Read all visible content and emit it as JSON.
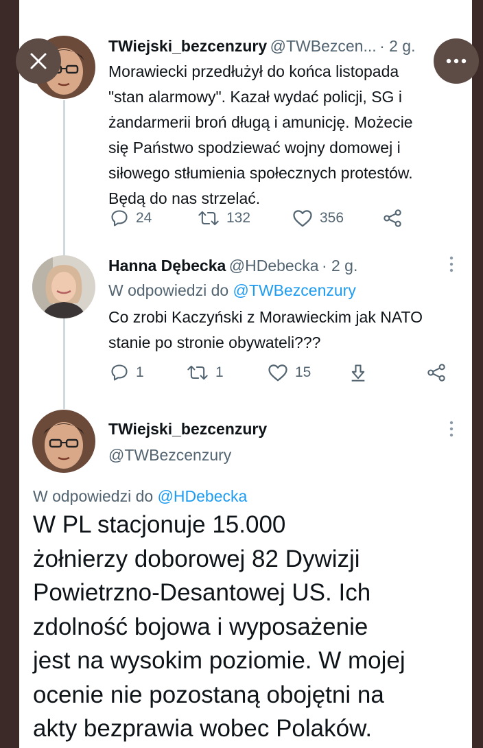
{
  "tweet1": {
    "name": "TWiejski_bezcenzury",
    "handle": "@TWBezcen...",
    "time": "· 2 g.",
    "lines": [
      "Morawiecki przedłużył do końca listopada",
      "\"stan alarmowy\". Kazał wydać policji, SG i",
      "żandarmerii broń długą i amunicję. Możecie",
      "się Państwo spodziewać wojny domowej i",
      "siłowego stłumienia społecznych protestów.",
      "Będą do nas strzelać."
    ],
    "replies": "24",
    "retweets": "132",
    "likes": "356"
  },
  "tweet2": {
    "name": "Hanna Dębecka",
    "handle": "@HDebecka",
    "time": "· 2 g.",
    "reply_prefix": "W odpowiedzi do ",
    "reply_handle": "@TWBezcenzury",
    "lines": [
      "Co zrobi Kaczyński z Morawieckim jak NATO",
      "stanie po stronie obywateli???"
    ],
    "replies": "1",
    "retweets": "1",
    "likes": "15"
  },
  "tweet3": {
    "name": "TWiejski_bezcenzury",
    "handle": "@TWBezcenzury",
    "reply_prefix": "W odpowiedzi do ",
    "reply_handle": "@HDebecka",
    "lines": [
      "W PL stacjonuje 15.000",
      "żołnierzy doborowej 82 Dywizji",
      "Powietrzno-Desantowej US. Ich",
      "zdolność bojowa i wyposażenie",
      "jest na wysokim poziomie. W mojej",
      "ocenie nie pozostaną obojętni na",
      "akty bezprawia wobec Polaków."
    ]
  },
  "icons": {
    "close": "close-icon",
    "more": "more-horizontal-icon",
    "reply": "comment-icon",
    "retweet": "retweet-icon",
    "like": "heart-icon",
    "share": "share-icon",
    "download": "download-icon",
    "kebab": "more-vertical-icon"
  },
  "colors": {
    "text": "#0f1419",
    "secondary": "#536471",
    "link": "#1d9bf0",
    "overlay_button": "#5d4b46",
    "frame": "#3b2a27"
  }
}
